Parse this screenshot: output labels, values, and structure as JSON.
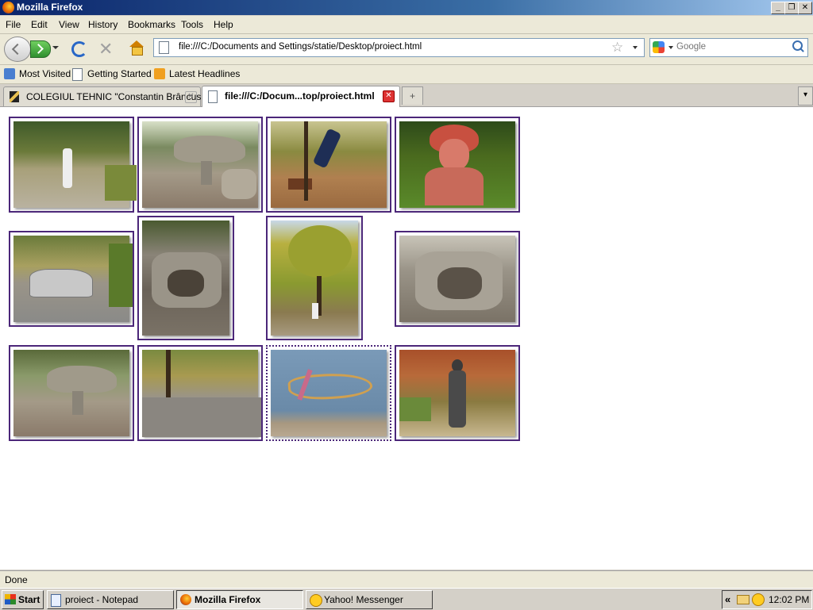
{
  "window": {
    "title": "Mozilla Firefox",
    "controls": {
      "minimize": "_",
      "maximize": "❐",
      "close": "✕"
    }
  },
  "menu": {
    "items": [
      "File",
      "Edit",
      "View",
      "History",
      "Bookmarks",
      "Tools",
      "Help"
    ]
  },
  "nav": {
    "url": "file:///C:/Documents and Settings/statie/Desktop/proiect.html",
    "search_placeholder": "Google",
    "icons": [
      "back-icon",
      "forward-icon",
      "reload-icon",
      "stop-icon",
      "home-icon",
      "bookmark-star-icon",
      "search-magnifier-icon"
    ]
  },
  "bookmarks": {
    "items": [
      "Most Visited",
      "Getting Started",
      "Latest Headlines"
    ]
  },
  "tabs": {
    "items": [
      {
        "label": "COLEGIUL TEHNIC \"Constantin Brâncusi\"",
        "active": false
      },
      {
        "label": "file:///C:/Docum...top/proiect.html",
        "active": true
      }
    ],
    "new_tab": "+",
    "list_all": "▾"
  },
  "gallery": {
    "rows": [
      [
        {
          "photo": "path-walker-park"
        },
        {
          "photo": "stone-table-sculpture"
        },
        {
          "photo": "jumping-person-bench"
        },
        {
          "photo": "red-child-statue"
        }
      ],
      [
        {
          "photo": "silver-car-road"
        },
        {
          "photo": "stone-fountain-portrait"
        },
        {
          "photo": "yellow-tree-portrait"
        },
        {
          "photo": "stone-fountain"
        }
      ],
      [
        {
          "photo": "stone-table-sculpture-2"
        },
        {
          "photo": "empty-park-road"
        },
        {
          "photo": "graffiti-wall"
        },
        {
          "photo": "bronze-statue-autumn"
        }
      ]
    ],
    "border_color": "#4b2679"
  },
  "status": {
    "text": "Done"
  },
  "taskbar": {
    "start": "Start",
    "tasks": [
      {
        "label": "proiect - Notepad",
        "active": false
      },
      {
        "label": "Mozilla Firefox",
        "active": true
      },
      {
        "label": "Yahoo! Messenger",
        "active": false
      }
    ],
    "tray_chevron": "«",
    "clock": "12:02 PM"
  }
}
